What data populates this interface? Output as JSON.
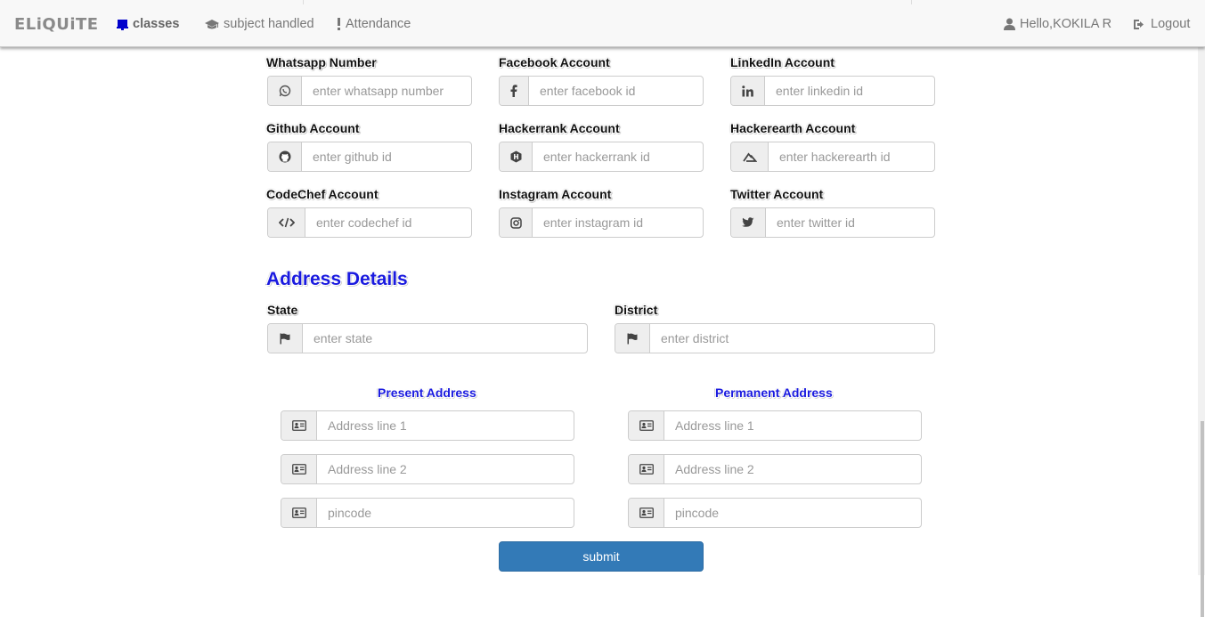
{
  "navbar": {
    "brand": "ELiQUiTE",
    "classes": "classes",
    "subject_handled": "subject handled",
    "attendance": "Attendance",
    "user": "Hello,KOKILA R",
    "logout": "Logout",
    "classes_icon_color": "#0000cc"
  },
  "social": {
    "whatsapp": {
      "label": "Whatsapp Number",
      "placeholder": "enter whatsapp number",
      "icon": "whatsapp-icon"
    },
    "facebook": {
      "label": "Facebook Account",
      "placeholder": "enter facebook id",
      "icon": "facebook-icon"
    },
    "linkedin": {
      "label": "LinkedIn Account",
      "placeholder": "enter linkedin id",
      "icon": "linkedin-icon"
    },
    "github": {
      "label": "Github Account",
      "placeholder": "enter github id",
      "icon": "github-icon"
    },
    "hackerrank": {
      "label": "Hackerrank Account",
      "placeholder": "enter hackerrank id",
      "icon": "hackerrank-icon"
    },
    "hackerearth": {
      "label": "Hackerearth Account",
      "placeholder": "enter hackerearth id",
      "icon": "hackerearth-icon"
    },
    "codechef": {
      "label": "CodeChef Account",
      "placeholder": "enter codechef id",
      "icon": "code-icon"
    },
    "instagram": {
      "label": "Instagram Account",
      "placeholder": "enter instagram id",
      "icon": "instagram-icon"
    },
    "twitter": {
      "label": "Twitter Account",
      "placeholder": "enter twitter id",
      "icon": "twitter-icon"
    }
  },
  "address": {
    "title": "Address Details",
    "state": {
      "label": "State",
      "placeholder": "enter state"
    },
    "district": {
      "label": "District",
      "placeholder": "enter district"
    },
    "present": {
      "title": "Present Address",
      "line1": "Address line 1",
      "line2": "Address line 2",
      "pincode": "pincode"
    },
    "permanent": {
      "title": "Permanent Address",
      "line1": "Address line 1",
      "line2": "Address line 2",
      "pincode": "pincode"
    }
  },
  "submit_label": "submit",
  "colors": {
    "accent_blue": "#1a1adf",
    "button": "#337ab7"
  }
}
